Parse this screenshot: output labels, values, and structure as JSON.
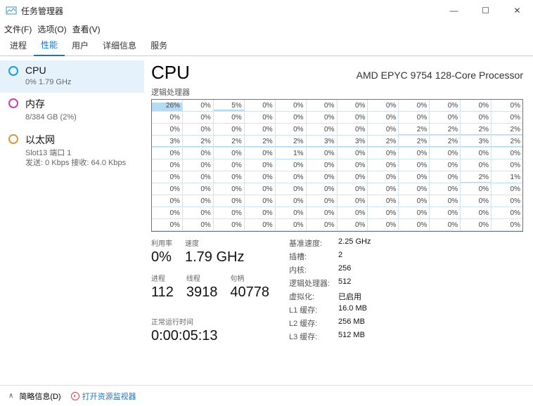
{
  "window": {
    "title": "任务管理器"
  },
  "menu": {
    "file": "文件(F)",
    "options": "选项(O)",
    "view": "查看(V)"
  },
  "tabs": [
    "进程",
    "性能",
    "用户",
    "详细信息",
    "服务"
  ],
  "activeTab": 1,
  "sidebar": [
    {
      "kind": "cpu",
      "title": "CPU",
      "sub": "0%  1.79 GHz",
      "selected": true
    },
    {
      "kind": "mem",
      "title": "内存",
      "sub": "8/384 GB (2%)"
    },
    {
      "kind": "eth",
      "title": "以太网",
      "sub": "Slot13 端口 1\n发送: 0 Kbps  接收: 64.0 Kbps"
    }
  ],
  "main": {
    "heading": "CPU",
    "cpuName": "AMD EPYC 9754 128-Core Processor",
    "graphLabel": "逻辑处理器",
    "cores": [
      [
        26,
        0,
        5,
        0,
        0,
        0,
        0,
        0,
        0,
        0,
        0,
        0
      ],
      [
        0,
        0,
        0,
        0,
        0,
        0,
        0,
        0,
        0,
        0,
        0,
        0
      ],
      [
        0,
        0,
        0,
        0,
        0,
        0,
        0,
        0,
        2,
        2,
        2,
        2
      ],
      [
        3,
        2,
        2,
        2,
        2,
        3,
        3,
        2,
        2,
        2,
        3,
        2
      ],
      [
        0,
        0,
        0,
        0,
        1,
        0,
        0,
        0,
        0,
        0,
        0,
        0
      ],
      [
        0,
        0,
        0,
        0,
        0,
        0,
        0,
        0,
        0,
        0,
        0,
        0
      ],
      [
        0,
        0,
        0,
        0,
        0,
        0,
        0,
        0,
        0,
        0,
        2,
        1
      ],
      [
        0,
        0,
        0,
        0,
        0,
        0,
        0,
        0,
        0,
        0,
        0,
        0
      ],
      [
        0,
        0,
        0,
        0,
        0,
        0,
        0,
        0,
        0,
        0,
        0,
        0
      ],
      [
        0,
        0,
        0,
        0,
        0,
        0,
        0,
        0,
        0,
        0,
        0,
        0
      ],
      [
        0,
        0,
        0,
        0,
        0,
        0,
        0,
        0,
        0,
        0,
        0,
        0
      ]
    ],
    "stats": {
      "util_lbl": "利用率",
      "util_val": "0%",
      "speed_lbl": "速度",
      "speed_val": "1.79 GHz",
      "proc_lbl": "进程",
      "proc_val": "112",
      "thread_lbl": "线程",
      "thread_val": "3918",
      "handle_lbl": "句柄",
      "handle_val": "40778",
      "uptime_lbl": "正常运行时间",
      "uptime_val": "0:00:05:13"
    },
    "right": [
      {
        "k": "基准速度:",
        "v": "2.25 GHz"
      },
      {
        "k": "插槽:",
        "v": "2"
      },
      {
        "k": "内核:",
        "v": "256"
      },
      {
        "k": "逻辑处理器:",
        "v": "512"
      },
      {
        "k": "虚拟化:",
        "v": "已启用"
      },
      {
        "k": "L1 缓存:",
        "v": "16.0 MB"
      },
      {
        "k": "L2 缓存:",
        "v": "256 MB"
      },
      {
        "k": "L3 缓存:",
        "v": "512 MB"
      }
    ]
  },
  "footer": {
    "brief": "简略信息(D)",
    "resmon": "打开资源监视器"
  }
}
